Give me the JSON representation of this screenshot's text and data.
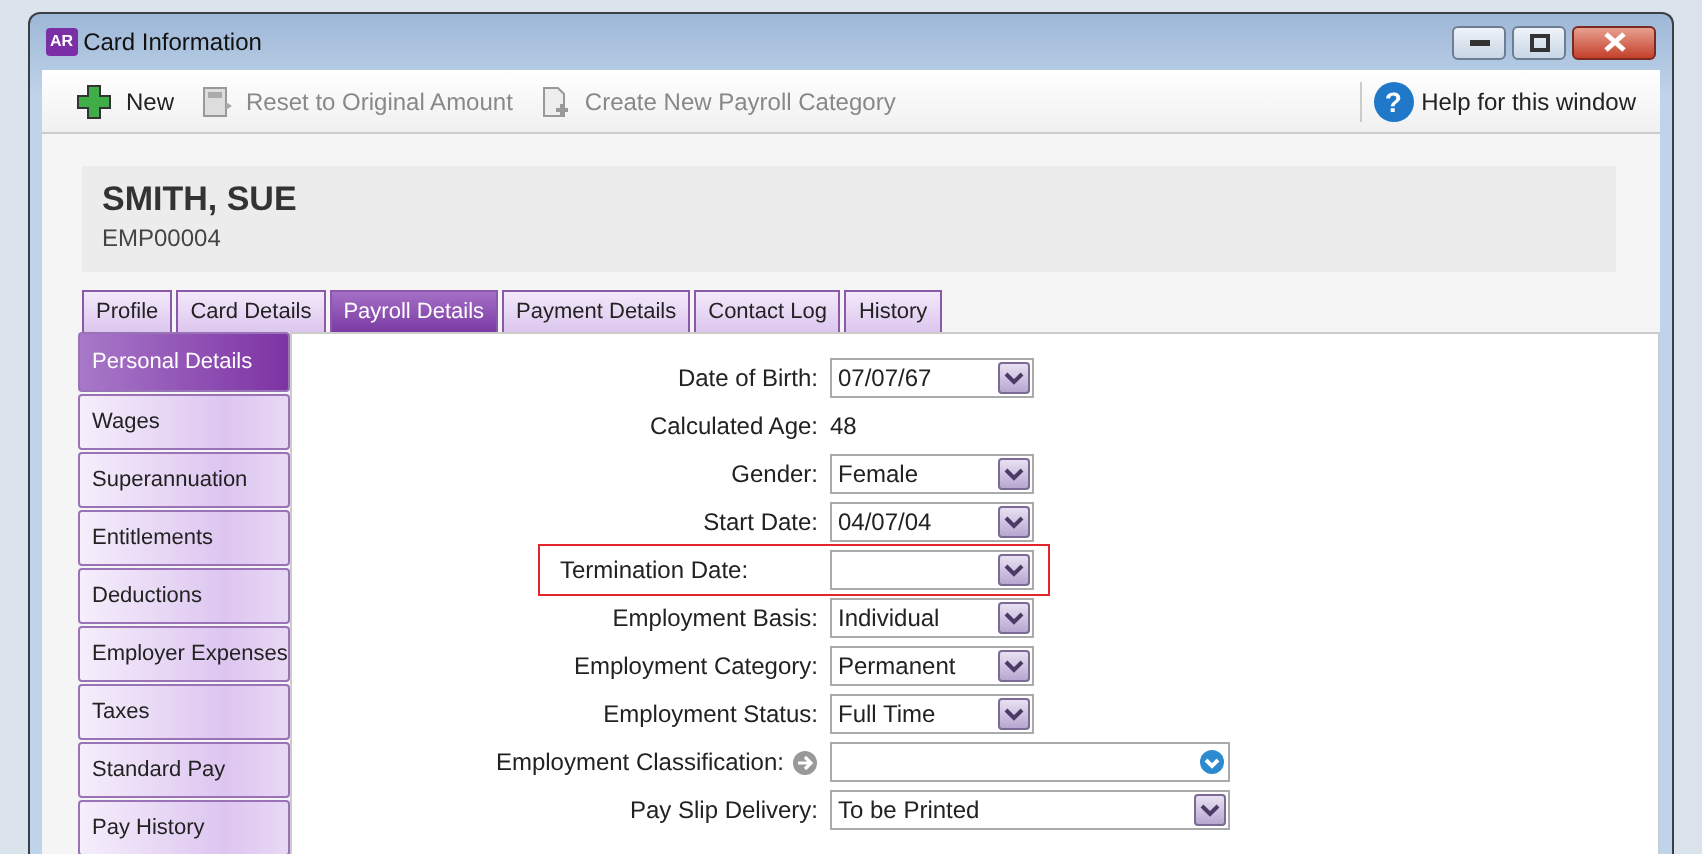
{
  "window": {
    "title": "Card Information",
    "app_badge": "AR"
  },
  "toolbar": {
    "buttons": [
      {
        "label": "New",
        "disabled": false,
        "kind": "new"
      },
      {
        "label": "Reset to Original Amount",
        "disabled": true,
        "kind": "reset"
      },
      {
        "label": "Create New Payroll Category",
        "disabled": true,
        "kind": "create"
      }
    ],
    "help": {
      "icon": "?",
      "label": "Help for this window"
    }
  },
  "header": {
    "name": "SMITH, SUE",
    "id": "EMP00004"
  },
  "tabs": [
    {
      "label": "Profile",
      "selected": false
    },
    {
      "label": "Card Details",
      "selected": false
    },
    {
      "label": "Payroll Details",
      "selected": true
    },
    {
      "label": "Payment Details",
      "selected": false
    },
    {
      "label": "Contact Log",
      "selected": false
    },
    {
      "label": "History",
      "selected": false
    }
  ],
  "sidebar": {
    "items": [
      {
        "label": "Personal Details",
        "selected": true
      },
      {
        "label": "Wages",
        "selected": false
      },
      {
        "label": "Superannuation",
        "selected": false
      },
      {
        "label": "Entitlements",
        "selected": false
      },
      {
        "label": "Deductions",
        "selected": false
      },
      {
        "label": "Employer Expenses",
        "selected": false
      },
      {
        "label": "Taxes",
        "selected": false
      },
      {
        "label": "Standard Pay",
        "selected": false
      },
      {
        "label": "Pay History",
        "selected": false
      }
    ]
  },
  "form": {
    "fields": [
      {
        "label": "Date of Birth:",
        "kind": "select",
        "value": "07/07/67",
        "highlighted": false
      },
      {
        "label": "Calculated Age:",
        "kind": "text",
        "value": "48",
        "highlighted": false
      },
      {
        "label": "Gender:",
        "kind": "select",
        "value": "Female",
        "highlighted": false
      },
      {
        "label": "Start Date:",
        "kind": "select",
        "value": "04/07/04",
        "highlighted": false
      },
      {
        "label": "Termination Date:",
        "kind": "select",
        "highlighted": true
      },
      {
        "label": "Employment Basis:",
        "kind": "select",
        "value": "Individual",
        "highlighted": false
      },
      {
        "label": "Employment Category:",
        "kind": "select",
        "value": "Permanent",
        "highlighted": false
      },
      {
        "label": "Employment Status:",
        "kind": "select",
        "value": "Full Time",
        "highlighted": false
      },
      {
        "label": "Employment Classification:",
        "kind": "lookup",
        "highlighted": false
      },
      {
        "label": "Pay Slip Delivery:",
        "kind": "wide-select",
        "value": "To be Printed",
        "highlighted": false
      }
    ]
  }
}
